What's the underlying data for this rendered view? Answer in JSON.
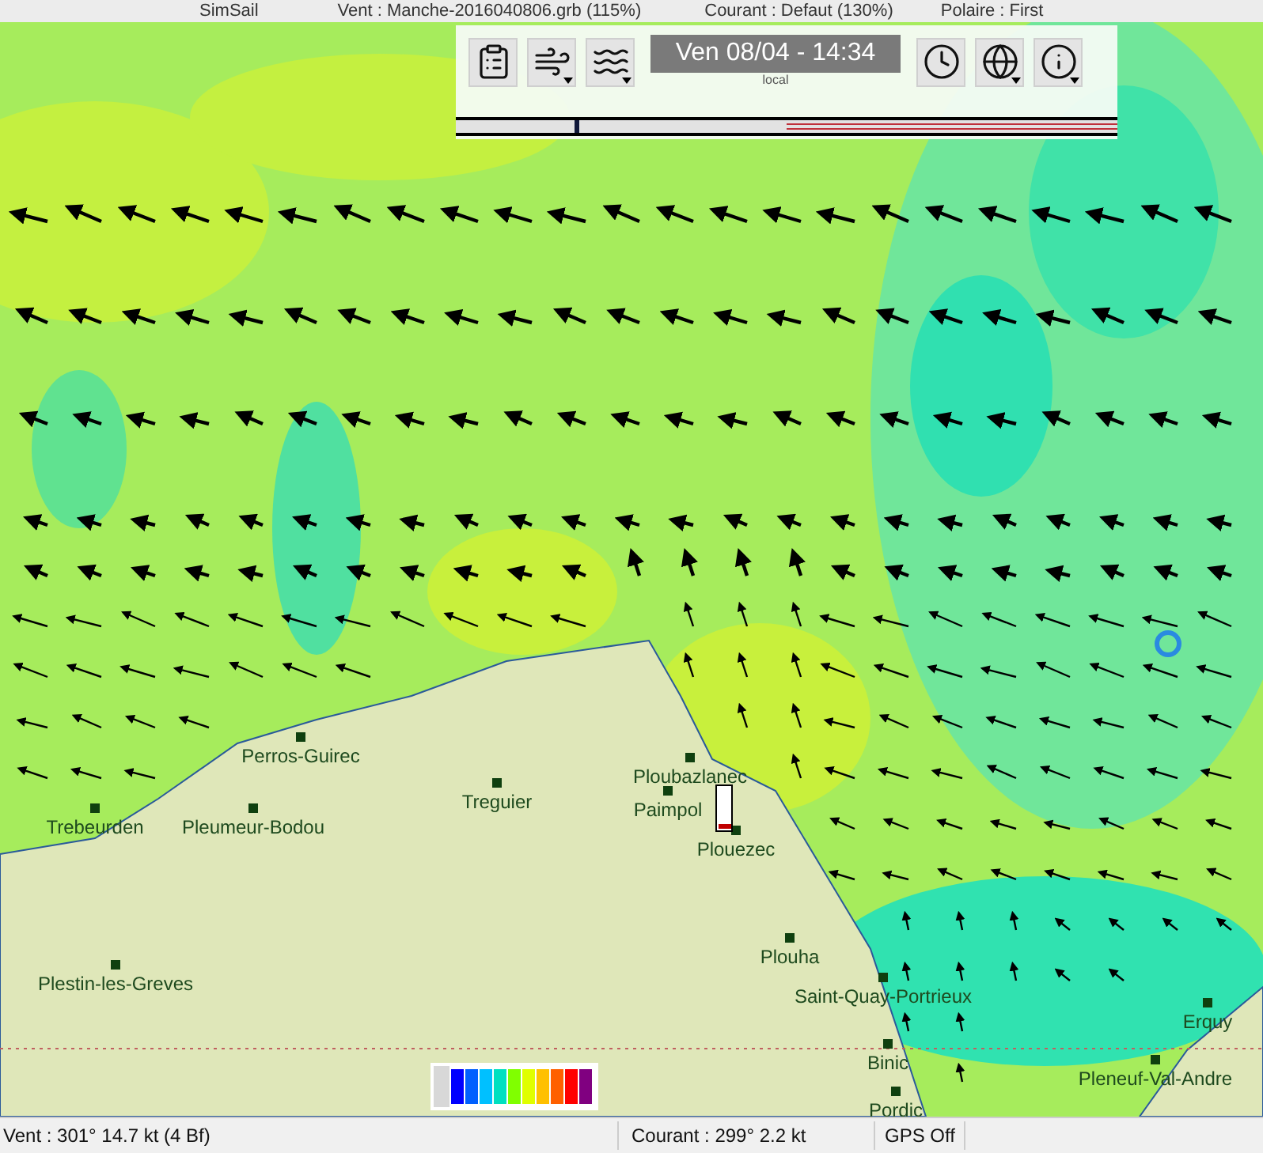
{
  "header": {
    "items": [
      "SimSail",
      "Vent : Manche-2016040806.grb (115%)",
      "Courant : Defaut (130%)",
      "Polaire : First"
    ]
  },
  "toolbar": {
    "buttons": [
      {
        "kind": "clipboard",
        "dropdown": false
      },
      {
        "kind": "wind",
        "dropdown": true
      },
      {
        "kind": "waves",
        "dropdown": true
      },
      {
        "kind": "date"
      },
      {
        "kind": "clock",
        "dropdown": false
      },
      {
        "kind": "globe",
        "dropdown": true
      },
      {
        "kind": "info",
        "dropdown": true
      }
    ],
    "date": "Ven 08/04 - 14:34",
    "timezone": "local",
    "timeline": {
      "level": 0.18
    }
  },
  "map": {
    "places": [
      {
        "name": "Perros-Guirec"
      },
      {
        "name": "Treguier"
      },
      {
        "name": "Trebeurden"
      },
      {
        "name": "Pleumeur-Bodou"
      },
      {
        "name": "Ploubazlanec"
      },
      {
        "name": "Paimpol"
      },
      {
        "name": "Plouezec"
      },
      {
        "name": "Plouha"
      },
      {
        "name": "Saint-Quay-Portrieux"
      },
      {
        "name": "Binic"
      },
      {
        "name": "Pordic"
      },
      {
        "name": "Plestin-les-Greves"
      },
      {
        "name": "Erquy"
      },
      {
        "name": "Pleneuf-Val-Andre"
      }
    ]
  },
  "legend": {
    "colors": [
      {
        "color": "#0000ff"
      },
      {
        "color": "#0060ff"
      },
      {
        "color": "#00c0ff"
      },
      {
        "color": "#00e0c0"
      },
      {
        "color": "#80ff00"
      },
      {
        "color": "#e0ff00"
      },
      {
        "color": "#ffc000"
      },
      {
        "color": "#ff6000"
      },
      {
        "color": "#ff0000"
      },
      {
        "color": "#800080"
      }
    ]
  },
  "status_bar": {
    "wind": "Vent : 301° 14.7 kt (4 Bf)",
    "current": "Courant : 299° 2.2 kt",
    "gps": "GPS Off"
  }
}
